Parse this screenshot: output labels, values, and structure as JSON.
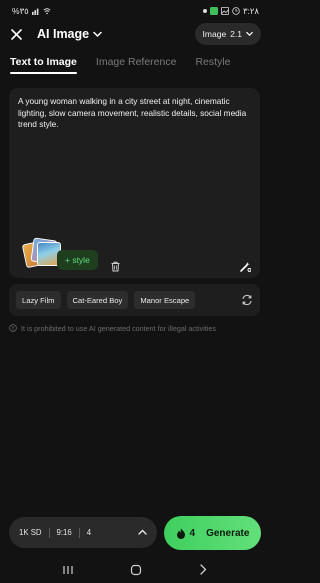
{
  "status_bar": {
    "battery_percent": "%٣٥",
    "time": "٣:٢٨"
  },
  "header": {
    "title": "AI Image",
    "model_name": "Image",
    "model_version": "2.1"
  },
  "tabs": [
    {
      "label": "Text to Image",
      "active": true
    },
    {
      "label": "Image Reference",
      "active": false
    },
    {
      "label": "Restyle",
      "active": false
    }
  ],
  "prompt": {
    "text": "A young woman walking in a city street at night, cinematic lighting, slow camera movement, realistic details, social media trend style.",
    "style_chip_label": "+ style"
  },
  "presets": [
    "Lazy Film",
    "Cat-Eared Boy",
    "Manor Escape"
  ],
  "warning": "It is prohibited to use AI generated content for illegal activities",
  "settings": {
    "resolution": "1K SD",
    "aspect_ratio": "9:16",
    "count": "4"
  },
  "generate": {
    "credits": "4",
    "label": "Generate"
  },
  "colors": {
    "background": "#121212",
    "card": "#1e1e1e",
    "accent_green": "#4cd964",
    "style_chip_text": "#5ee07a"
  }
}
